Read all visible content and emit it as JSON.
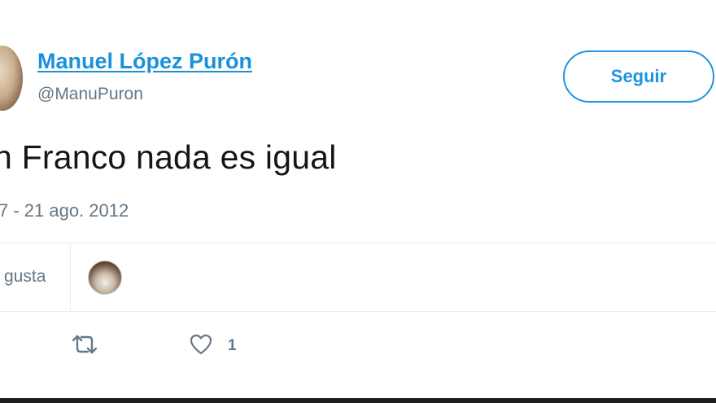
{
  "user": {
    "display_name": "Manuel López Purón",
    "handle": "@ManuPuron",
    "avatar_icon": "profile-photo"
  },
  "follow_button": {
    "label": "Seguir"
  },
  "tweet": {
    "text": "n Franco nada es igual",
    "meta": "7 - 21 ago. 2012"
  },
  "likes_section": {
    "label": "gusta"
  },
  "actions": {
    "retweet_icon": "retweet-icon",
    "like_icon": "heart-icon",
    "like_count": "1"
  },
  "colors": {
    "link": "#1a91da",
    "accent": "#1b95e0",
    "secondary_text": "#657786",
    "divider": "#e6ecf0"
  }
}
